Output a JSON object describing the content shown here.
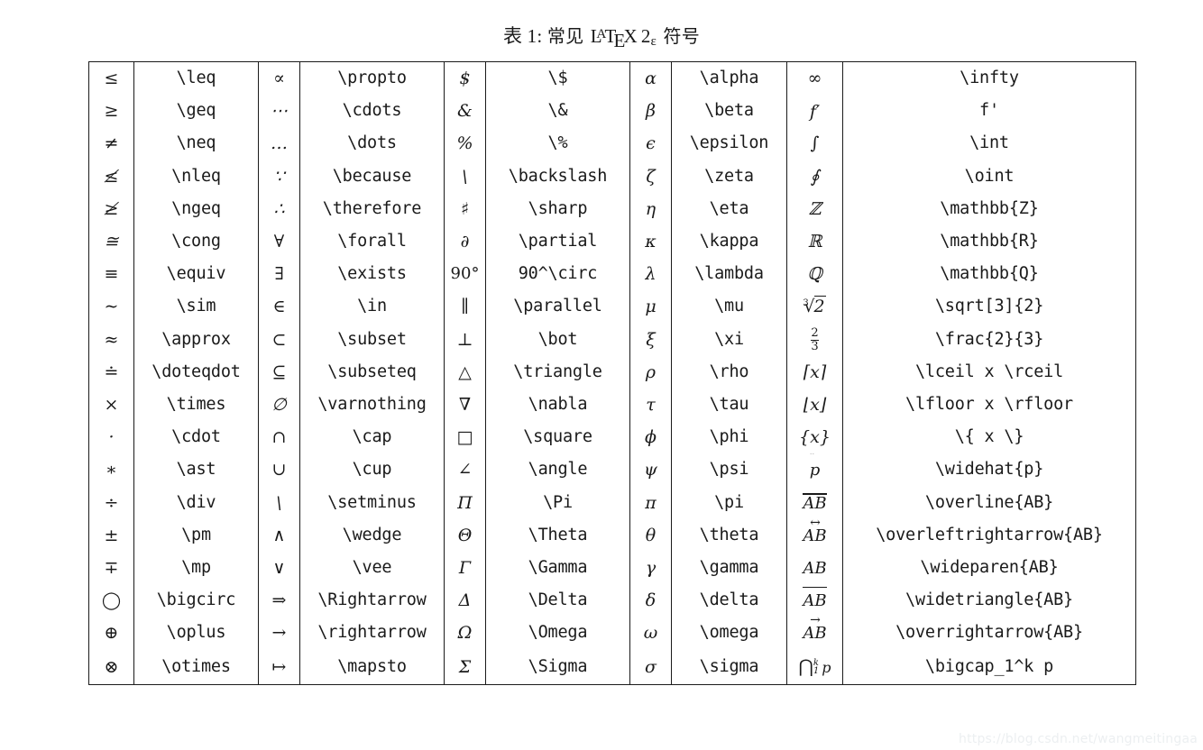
{
  "caption": {
    "label": "表 1:",
    "before_logo": "常见",
    "logo": {
      "l": "L",
      "a": "A",
      "t": "T",
      "e": "E",
      "x": "X",
      "version": "2",
      "epsilon": "ε"
    },
    "after_logo": "符号",
    "full_text": "表 1: 常见 LaTeX 2ε 符号"
  },
  "table": {
    "column_count": 10,
    "row_count": 20,
    "pair_count": 5,
    "columns": [
      {
        "kind": "symbol",
        "name": "symbol-col-1"
      },
      {
        "kind": "command",
        "name": "command-col-1"
      },
      {
        "kind": "symbol",
        "name": "symbol-col-2"
      },
      {
        "kind": "command",
        "name": "command-col-2"
      },
      {
        "kind": "symbol",
        "name": "symbol-col-3"
      },
      {
        "kind": "command",
        "name": "command-col-3"
      },
      {
        "kind": "symbol",
        "name": "symbol-col-4"
      },
      {
        "kind": "command",
        "name": "command-col-4"
      },
      {
        "kind": "symbol",
        "name": "symbol-col-5"
      },
      {
        "kind": "command",
        "name": "command-col-5"
      }
    ],
    "rows": [
      {
        "s1": "≤",
        "c1": "\\leq",
        "s2": "∝",
        "c2": "\\propto",
        "s3": "$",
        "c3": "\\$",
        "s4": "α",
        "c4": "\\alpha",
        "s5": "∞",
        "c5": "\\infty"
      },
      {
        "s1": "≥",
        "c1": "\\geq",
        "s2": "⋯",
        "c2": "\\cdots",
        "s3": "&",
        "c3": "\\&",
        "s4": "β",
        "c4": "\\beta",
        "s5": "f′",
        "c5": "f'"
      },
      {
        "s1": "≠",
        "c1": "\\neq",
        "s2": "…",
        "c2": "\\dots",
        "s3": "%",
        "c3": "\\%",
        "s4": "ϵ",
        "c4": "\\epsilon",
        "s5": "∫",
        "c5": "\\int"
      },
      {
        "s1": "≰",
        "c1": "\\nleq",
        "s2": "∵",
        "c2": "\\because",
        "s3": "\\",
        "c3": "\\backslash",
        "s4": "ζ",
        "c4": "\\zeta",
        "s5": "∮",
        "c5": "\\oint"
      },
      {
        "s1": "≱",
        "c1": "\\ngeq",
        "s2": "∴",
        "c2": "\\therefore",
        "s3": "♯",
        "c3": "\\sharp",
        "s4": "η",
        "c4": "\\eta",
        "s5": "ℤ",
        "c5": "\\mathbb{Z}"
      },
      {
        "s1": "≅",
        "c1": "\\cong",
        "s2": "∀",
        "c2": "\\forall",
        "s3": "∂",
        "c3": "\\partial",
        "s4": "κ",
        "c4": "\\kappa",
        "s5": "ℝ",
        "c5": "\\mathbb{R}"
      },
      {
        "s1": "≡",
        "c1": "\\equiv",
        "s2": "∃",
        "c2": "\\exists",
        "s3": "90°",
        "c3": "90^\\circ",
        "s4": "λ",
        "c4": "\\lambda",
        "s5": "ℚ",
        "c5": "\\mathbb{Q}"
      },
      {
        "s1": "∼",
        "c1": "\\sim",
        "s2": "∈",
        "c2": "\\in",
        "s3": "∥",
        "c3": "\\parallel",
        "s4": "μ",
        "c4": "\\mu",
        "s5": "∛2",
        "c5": "\\sqrt[3]{2}"
      },
      {
        "s1": "≈",
        "c1": "\\approx",
        "s2": "⊂",
        "c2": "\\subset",
        "s3": "⊥",
        "c3": "\\bot",
        "s4": "ξ",
        "c4": "\\xi",
        "s5": "2/3",
        "c5": "\\frac{2}{3}"
      },
      {
        "s1": "≐",
        "c1": "\\doteqdot",
        "s2": "⊆",
        "c2": "\\subseteq",
        "s3": "△",
        "c3": "\\triangle",
        "s4": "ρ",
        "c4": "\\rho",
        "s5": "⌈x⌉",
        "c5": "\\lceil x \\rceil"
      },
      {
        "s1": "×",
        "c1": "\\times",
        "s2": "∅",
        "c2": "\\varnothing",
        "s3": "∇",
        "c3": "\\nabla",
        "s4": "τ",
        "c4": "\\tau",
        "s5": "⌊x⌋",
        "c5": "\\lfloor x \\rfloor"
      },
      {
        "s1": "·",
        "c1": "\\cdot",
        "s2": "∩",
        "c2": "\\cap",
        "s3": "□",
        "c3": "\\square",
        "s4": "ϕ",
        "c4": "\\phi",
        "s5": "{x}",
        "c5": "\\{ x \\}"
      },
      {
        "s1": "∗",
        "c1": "\\ast",
        "s2": "∪",
        "c2": "\\cup",
        "s3": "∠",
        "c3": "\\angle",
        "s4": "ψ",
        "c4": "\\psi",
        "s5": "p̂",
        "c5": "\\widehat{p}"
      },
      {
        "s1": "÷",
        "c1": "\\div",
        "s2": "\\",
        "c2": "\\setminus",
        "s3": "Π",
        "c3": "\\Pi",
        "s4": "π",
        "c4": "\\pi",
        "s5": "AB̄",
        "c5": "\\overline{AB}"
      },
      {
        "s1": "±",
        "c1": "\\pm",
        "s2": "∧",
        "c2": "\\wedge",
        "s3": "Θ",
        "c3": "\\Theta",
        "s4": "θ",
        "c4": "\\theta",
        "s5": "↔AB",
        "c5": "\\overleftrightarrow{AB}"
      },
      {
        "s1": "∓",
        "c1": "\\mp",
        "s2": "∨",
        "c2": "\\vee",
        "s3": "Γ",
        "c3": "\\Gamma",
        "s4": "γ",
        "c4": "\\gamma",
        "s5": "⌒AB",
        "c5": "\\wideparen{AB}"
      },
      {
        "s1": "◯",
        "c1": "\\bigcirc",
        "s2": "⇒",
        "c2": "\\Rightarrow",
        "s3": "Δ",
        "c3": "\\Delta",
        "s4": "δ",
        "c4": "\\delta",
        "s5": "△AB",
        "c5": "\\widetriangle{AB}"
      },
      {
        "s1": "⊕",
        "c1": "\\oplus",
        "s2": "→",
        "c2": "\\rightarrow",
        "s3": "Ω",
        "c3": "\\Omega",
        "s4": "ω",
        "c4": "\\omega",
        "s5": "→AB",
        "c5": "\\overrightarrow{AB}"
      },
      {
        "s1": "⊗",
        "c1": "\\otimes",
        "s2": "↦",
        "c2": "\\mapsto",
        "s3": "Σ",
        "c3": "\\Sigma",
        "s4": "σ",
        "c4": "\\sigma",
        "s5": "⋂₁ᵏ p",
        "c5": "\\bigcap_1^k p"
      }
    ]
  },
  "watermark": {
    "text": "https://blog.csdn.net/wangmeitingaa"
  },
  "colors": {
    "ink": "#1a1a1a",
    "background": "#ffffff",
    "watermark": "#eceff1"
  }
}
